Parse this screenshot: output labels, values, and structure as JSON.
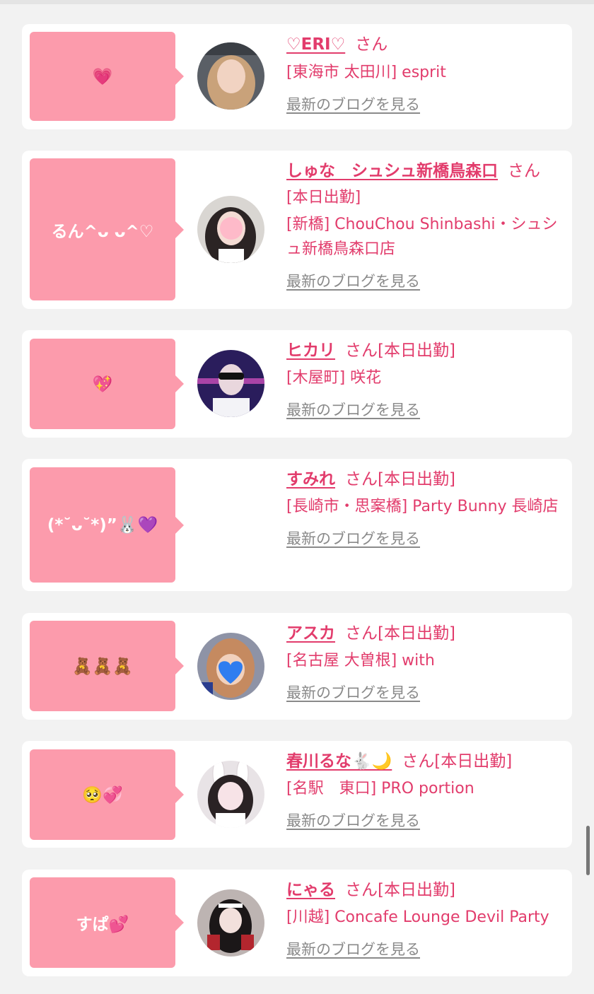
{
  "entries": [
    {
      "message": "💗",
      "name": "♡ERI♡",
      "honorific": "さん",
      "status": "",
      "details": [
        "[東海市 太田川] esprit"
      ],
      "blog_link": "最新のブログを見る",
      "avatar": "photo"
    },
    {
      "message": "るん^ᴗ ᴗ^♡",
      "name": "しゅな　シュシュ新橋鳥森口",
      "honorific": "さん",
      "status": "",
      "details": [
        "[本日出勤]",
        "[新橋] ChouChou Shinbashi・シュシュ新橋鳥森口店"
      ],
      "blog_link": "最新のブログを見る",
      "avatar": "photo"
    },
    {
      "message": "💖",
      "name": "ヒカリ",
      "honorific": "さん",
      "status": "[本日出勤]",
      "details": [
        "[木屋町] 咲花"
      ],
      "blog_link": "最新のブログを見る",
      "avatar": "photo"
    },
    {
      "message": "(*˘ᴗ˘*)”🐰💜",
      "name": "すみれ",
      "honorific": "さん",
      "status": "[本日出勤]",
      "details": [
        "[長崎市・思案橋] Party Bunny 長崎店"
      ],
      "blog_link": "最新のブログを見る",
      "avatar": "blank"
    },
    {
      "message": "🧸🧸🧸",
      "name": "アスカ",
      "honorific": "さん",
      "status": "[本日出勤]",
      "details": [
        "[名古屋 大曽根] with"
      ],
      "blog_link": "最新のブログを見る",
      "avatar": "photo"
    },
    {
      "message": "🥺💞",
      "name": "春川るな🐇🌙",
      "honorific": "さん",
      "status": "[本日出勤]",
      "details": [
        "[名駅　東口] PRO portion"
      ],
      "blog_link": "最新のブログを見る",
      "avatar": "photo"
    },
    {
      "message": "すぱ💕",
      "name": "にゃる",
      "honorific": "さん",
      "status": "[本日出勤]",
      "details": [
        "[川越] Concafe Lounge Devil Party"
      ],
      "blog_link": "最新のブログを見る",
      "avatar": "photo"
    }
  ],
  "colors": {
    "accent": "#e23c6c",
    "bubble": "#fc9bac",
    "link_gray": "#8a8a8a",
    "page_bg": "#f2f2f2"
  }
}
